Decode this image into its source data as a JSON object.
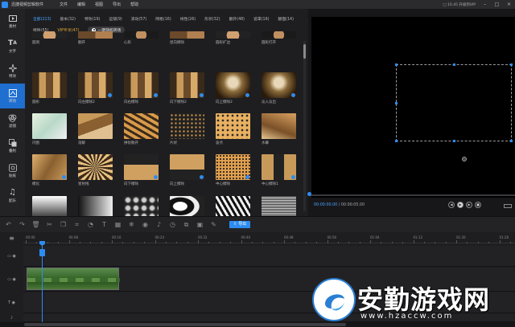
{
  "app": {
    "title": "迅捷视频剪辑软件",
    "menu": [
      "文件",
      "编辑",
      "视图",
      "导出",
      "帮助"
    ],
    "version": "□ 10.45 升级到VIP"
  },
  "sidebar": {
    "items": [
      {
        "label": "素材",
        "icon": "media-icon"
      },
      {
        "label": "文字",
        "icon": "text-icon"
      },
      {
        "label": "特效",
        "icon": "effects-icon"
      },
      {
        "label": "转场",
        "icon": "transition-icon"
      },
      {
        "label": "滤镜",
        "icon": "filter-icon"
      },
      {
        "label": "叠附",
        "icon": "overlay-icon"
      },
      {
        "label": "贴纸",
        "icon": "sticker-icon"
      },
      {
        "label": "配乐",
        "icon": "music-icon"
      }
    ],
    "active": 3
  },
  "library": {
    "categories_row1": [
      "全部(213)",
      "基本(32)",
      "特效(19)",
      "运镜(9)",
      "滚动(57)",
      "网格(16)",
      "线性(26)",
      "形状(32)",
      "翻开(48)",
      "遮罩(16)",
      "翻面(14)"
    ],
    "categories_row2": [
      "擦除(55)",
      "VIP专享(47)"
    ],
    "apply_all_label": "一键随机转场",
    "tiles": [
      {
        "label": "圆洞",
        "style": "img1",
        "download": false
      },
      {
        "label": "翻开",
        "style": "img2",
        "download": false
      },
      {
        "label": "心形",
        "style": "img3",
        "download": false
      },
      {
        "label": "径向擦除",
        "style": "img2",
        "download": false
      },
      {
        "label": "圆形扩边",
        "style": "img1",
        "download": false
      },
      {
        "label": "圆形打开",
        "style": "img3",
        "download": false
      },
      {
        "label": "圆形",
        "style": "alley",
        "download": false
      },
      {
        "label": "向左擦除2",
        "style": "alley",
        "download": true
      },
      {
        "label": "向右擦除",
        "style": "alley",
        "download": true
      },
      {
        "label": "向下擦除2",
        "style": "alley",
        "download": true
      },
      {
        "label": "向上擦除2",
        "style": "alley2",
        "download": true
      },
      {
        "label": "淡入淡出",
        "style": "alley2",
        "download": true
      },
      {
        "label": "闪图",
        "style": "flash",
        "download": false
      },
      {
        "label": "溶解",
        "style": "dog",
        "download": false
      },
      {
        "label": "拼砂散开",
        "style": "shards",
        "download": false
      },
      {
        "label": "片状",
        "style": "dots",
        "download": false
      },
      {
        "label": "波点",
        "style": "dots2",
        "download": false
      },
      {
        "label": "水幕",
        "style": "dog2",
        "download": false
      },
      {
        "label": "模化",
        "style": "dog3",
        "download": true
      },
      {
        "label": "星射线",
        "style": "rays",
        "download": false
      },
      {
        "label": "向下擦除",
        "style": "dogsplit",
        "download": true
      },
      {
        "label": "向上擦除",
        "style": "dogsplit2",
        "download": true
      },
      {
        "label": "中心擦除",
        "style": "dots3",
        "download": true
      },
      {
        "label": "中心擦除1",
        "style": "dogsplit3",
        "download": true
      },
      {
        "label": "",
        "style": "grad1",
        "download": false
      },
      {
        "label": "",
        "style": "grad2",
        "download": false
      },
      {
        "label": "",
        "style": "bubbles",
        "download": false
      },
      {
        "label": "",
        "style": "blobs",
        "download": false
      },
      {
        "label": "",
        "style": "zebra",
        "download": false
      },
      {
        "label": "",
        "style": "noise",
        "download": false
      }
    ]
  },
  "preview": {
    "current_time": "00:00:00.00",
    "separator": " / ",
    "total_time": "00:00:05.00",
    "progress": 0
  },
  "toolbar": {
    "icons": [
      "undo-icon",
      "redo-icon",
      "delete-icon",
      "cut-icon",
      "copy-icon",
      "crop-icon",
      "speed-icon",
      "text-edit-icon",
      "mosaic-icon",
      "freeze-icon",
      "record-icon",
      "mic-icon",
      "timer-icon",
      "split-icon",
      "image-icon",
      "edit-icon"
    ],
    "export_label": "导出"
  },
  "timeline": {
    "ticks": [
      "00:00",
      "00:08",
      "00:16",
      "00:24",
      "00:32",
      "00:40",
      "00:48",
      "00:56",
      "01:04",
      "01:12",
      "01:20",
      "01:28"
    ]
  },
  "watermark": {
    "title": "安勤游戏网",
    "url": "www.hzaccw.com"
  },
  "colors": {
    "accent": "#2d8cf0",
    "vip": "#e0a534",
    "background": "#1b1b1d"
  }
}
